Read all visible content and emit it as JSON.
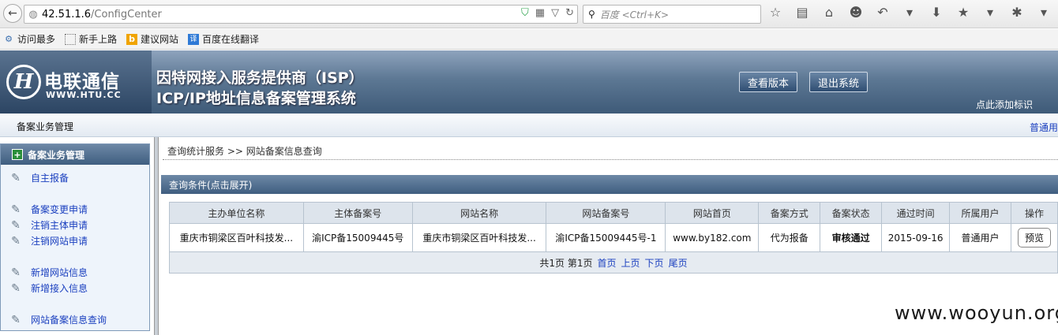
{
  "browser": {
    "url_host": "42.51.1.6",
    "url_path": "/ConfigCenter",
    "search_placeholder": "百度 <Ctrl+K>"
  },
  "bookmarks": [
    {
      "label": "访问最多",
      "icon": "gear-icon"
    },
    {
      "label": "新手上路",
      "icon": "folder-icon"
    },
    {
      "label": "建议网站",
      "icon": "bing-icon"
    },
    {
      "label": "百度在线翻译",
      "icon": "translate-icon"
    }
  ],
  "header": {
    "logo_cn": "电联通信",
    "logo_en": "WWW.HTU.CC",
    "title_line1": "因特网接入服务提供商（ISP）",
    "title_line2": "ICP/IP地址信息备案管理系统",
    "btn_version": "查看版本",
    "btn_logout": "退出系统",
    "bookmark_link": "点此添加标识"
  },
  "menu": {
    "left": "备案业务管理",
    "right": "普通用"
  },
  "sidebar": {
    "title": "备案业务管理",
    "items": [
      "自主报备",
      "备案变更申请",
      "注销主体申请",
      "注销网站申请",
      "新增网站信息",
      "新增接入信息",
      "网站备案信息查询"
    ]
  },
  "breadcrumb": "查询统计服务 >> 网站备案信息查询",
  "query_bar": "查询条件(点击展开)",
  "table": {
    "headers": [
      "主办单位名称",
      "主体备案号",
      "网站名称",
      "网站备案号",
      "网站首页",
      "备案方式",
      "备案状态",
      "通过时间",
      "所属用户",
      "操作"
    ],
    "rows": [
      [
        "重庆市铜梁区百叶科技发...",
        "渝ICP备15009445号",
        "重庆市铜梁区百叶科技发...",
        "渝ICP备15009445号-1",
        "www.by182.com",
        "代为报备",
        "审核通过",
        "2015-09-16",
        "普通用户",
        "预览"
      ]
    ]
  },
  "pager": {
    "summary": "共1页 第1页",
    "first": "首页",
    "prev": "上页",
    "next": "下页",
    "last": "尾页"
  },
  "watermark": "www.wooyun.org"
}
